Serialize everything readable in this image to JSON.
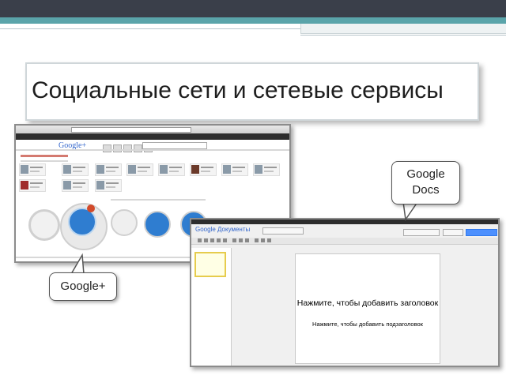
{
  "slide": {
    "title": "Социальные сети и сетевые сервисы"
  },
  "callouts": {
    "google_docs": "Google\nDocs",
    "google_docs_line1": "Google",
    "google_docs_line2": "Docs",
    "google_plus": "Google+"
  },
  "google_plus_screenshot": {
    "logo": "Google+"
  },
  "google_docs_screenshot": {
    "logo": "Google Документы",
    "title_placeholder": "Нажмите, чтобы добавить заголовок",
    "subtitle_placeholder": "Нажмите, чтобы добавить подзаголовок"
  },
  "colors": {
    "top_band": "#3a3f4a",
    "accent_stripe": "#5aa4aa",
    "google_blue": "#3366cc"
  }
}
